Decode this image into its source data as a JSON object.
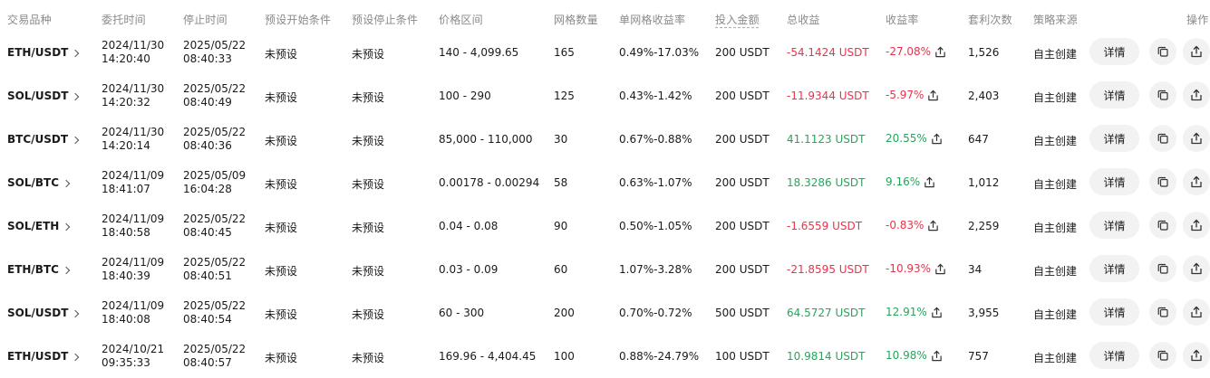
{
  "headers": {
    "pair": "交易品种",
    "entrust_time": "委托时间",
    "stop_time": "停止时间",
    "preset_start": "预设开始条件",
    "preset_stop": "预设停止条件",
    "price_range": "价格区间",
    "grid_count": "网格数量",
    "per_grid_return": "单网格收益率",
    "investment": "投入金额",
    "total_profit": "总收益",
    "yield": "收益率",
    "arbitrage_count": "套利次数",
    "source": "策略来源",
    "actions": "操作"
  },
  "colors": {
    "negative": "#e8334a",
    "positive": "#26a65b",
    "button_bg": "#f2f2f2"
  },
  "rows": [
    {
      "pair": "ETH/USDT",
      "entrust_date": "2024/11/30",
      "entrust_clock": "14:20:40",
      "stop_date": "2025/05/22",
      "stop_clock": "08:40:33",
      "preset_start": "未预设",
      "preset_stop": "未预设",
      "price_range": "140 - 4,099.65",
      "grids": "165",
      "per_grid": "0.49%-17.03%",
      "investment": "200 USDT",
      "profit": "-54.1424 USDT",
      "yield": "-27.08%",
      "arbitrage": "1,526",
      "source": "自主创建",
      "detail": "详情",
      "trend": "negative"
    },
    {
      "pair": "SOL/USDT",
      "entrust_date": "2024/11/30",
      "entrust_clock": "14:20:32",
      "stop_date": "2025/05/22",
      "stop_clock": "08:40:49",
      "preset_start": "未预设",
      "preset_stop": "未预设",
      "price_range": "100 - 290",
      "grids": "125",
      "per_grid": "0.43%-1.42%",
      "investment": "200 USDT",
      "profit": "-11.9344 USDT",
      "yield": "-5.97%",
      "arbitrage": "2,403",
      "source": "自主创建",
      "detail": "详情",
      "trend": "negative"
    },
    {
      "pair": "BTC/USDT",
      "entrust_date": "2024/11/30",
      "entrust_clock": "14:20:14",
      "stop_date": "2025/05/22",
      "stop_clock": "08:40:36",
      "preset_start": "未预设",
      "preset_stop": "未预设",
      "price_range": "85,000 - 110,000",
      "grids": "30",
      "per_grid": "0.67%-0.88%",
      "investment": "200 USDT",
      "profit": "41.1123 USDT",
      "yield": "20.55%",
      "arbitrage": "647",
      "source": "自主创建",
      "detail": "详情",
      "trend": "positive"
    },
    {
      "pair": "SOL/BTC",
      "entrust_date": "2024/11/09",
      "entrust_clock": "18:41:07",
      "stop_date": "2025/05/09",
      "stop_clock": "16:04:28",
      "preset_start": "未预设",
      "preset_stop": "未预设",
      "price_range": "0.00178 - 0.00294",
      "grids": "58",
      "per_grid": "0.63%-1.07%",
      "investment": "200 USDT",
      "profit": "18.3286 USDT",
      "yield": "9.16%",
      "arbitrage": "1,012",
      "source": "自主创建",
      "detail": "详情",
      "trend": "positive"
    },
    {
      "pair": "SOL/ETH",
      "entrust_date": "2024/11/09",
      "entrust_clock": "18:40:58",
      "stop_date": "2025/05/22",
      "stop_clock": "08:40:45",
      "preset_start": "未预设",
      "preset_stop": "未预设",
      "price_range": "0.04 - 0.08",
      "grids": "90",
      "per_grid": "0.50%-1.05%",
      "investment": "200 USDT",
      "profit": "-1.6559 USDT",
      "yield": "-0.83%",
      "arbitrage": "2,259",
      "source": "自主创建",
      "detail": "详情",
      "trend": "negative"
    },
    {
      "pair": "ETH/BTC",
      "entrust_date": "2024/11/09",
      "entrust_clock": "18:40:39",
      "stop_date": "2025/05/22",
      "stop_clock": "08:40:51",
      "preset_start": "未预设",
      "preset_stop": "未预设",
      "price_range": "0.03 - 0.09",
      "grids": "60",
      "per_grid": "1.07%-3.28%",
      "investment": "200 USDT",
      "profit": "-21.8595 USDT",
      "yield": "-10.93%",
      "arbitrage": "34",
      "source": "自主创建",
      "detail": "详情",
      "trend": "negative"
    },
    {
      "pair": "SOL/USDT",
      "entrust_date": "2024/11/09",
      "entrust_clock": "18:40:08",
      "stop_date": "2025/05/22",
      "stop_clock": "08:40:54",
      "preset_start": "未预设",
      "preset_stop": "未预设",
      "price_range": "60 - 300",
      "grids": "200",
      "per_grid": "0.70%-0.72%",
      "investment": "500 USDT",
      "profit": "64.5727 USDT",
      "yield": "12.91%",
      "arbitrage": "3,955",
      "source": "自主创建",
      "detail": "详情",
      "trend": "positive"
    },
    {
      "pair": "ETH/USDT",
      "entrust_date": "2024/10/21",
      "entrust_clock": "09:35:33",
      "stop_date": "2025/05/22",
      "stop_clock": "08:40:57",
      "preset_start": "未预设",
      "preset_stop": "未预设",
      "price_range": "169.96 - 4,404.45",
      "grids": "100",
      "per_grid": "0.88%-24.79%",
      "investment": "100 USDT",
      "profit": "10.9814 USDT",
      "yield": "10.98%",
      "arbitrage": "757",
      "source": "自主创建",
      "detail": "详情",
      "trend": "positive"
    }
  ]
}
